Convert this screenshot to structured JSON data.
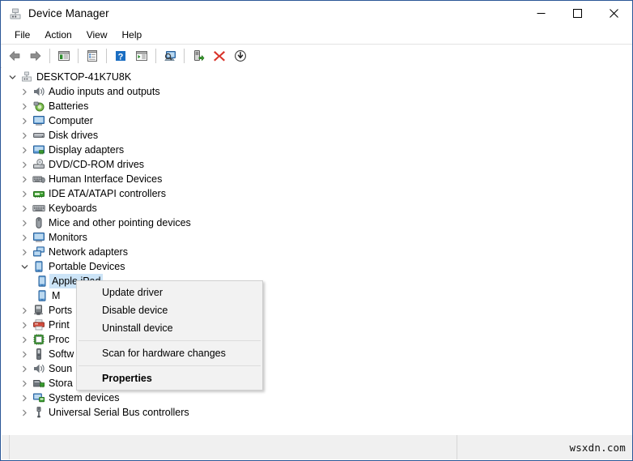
{
  "window": {
    "title": "Device Manager",
    "title_icon": "device-manager-icon",
    "caption": {
      "minimize": "minimize-icon",
      "maximize": "maximize-icon",
      "close": "close-icon"
    }
  },
  "menubar": {
    "items": [
      {
        "label": "File"
      },
      {
        "label": "Action"
      },
      {
        "label": "View"
      },
      {
        "label": "Help"
      }
    ]
  },
  "toolbar": {
    "buttons": [
      {
        "name": "back-button",
        "icon": "back-arrow-icon"
      },
      {
        "name": "forward-button",
        "icon": "forward-arrow-icon"
      },
      {
        "name": "show-hide-console-tree-button",
        "icon": "console-tree-icon"
      },
      {
        "name": "properties-button",
        "icon": "properties-icon"
      },
      {
        "name": "help-button",
        "icon": "help-question-icon"
      },
      {
        "name": "show-hide-action-pane-button",
        "icon": "action-pane-icon"
      },
      {
        "name": "scan-for-hardware-changes-button",
        "icon": "scan-hardware-icon"
      },
      {
        "name": "update-driver-button",
        "icon": "update-driver-icon"
      },
      {
        "name": "uninstall-device-button",
        "icon": "red-x-icon"
      },
      {
        "name": "disable-device-button",
        "icon": "disable-down-arrow-icon"
      }
    ]
  },
  "tree": {
    "root": {
      "label": "DESKTOP-41K7U8K",
      "icon": "computer-root-icon",
      "expanded": true
    },
    "nodes": [
      {
        "label": "Audio inputs and outputs",
        "icon": "speaker-icon",
        "depth": 1,
        "expanded": false
      },
      {
        "label": "Batteries",
        "icon": "battery-icon",
        "depth": 1,
        "expanded": false
      },
      {
        "label": "Computer",
        "icon": "monitor-icon",
        "depth": 1,
        "expanded": false
      },
      {
        "label": "Disk drives",
        "icon": "disk-drive-icon",
        "depth": 1,
        "expanded": false
      },
      {
        "label": "Display adapters",
        "icon": "display-adapter-icon",
        "depth": 1,
        "expanded": false
      },
      {
        "label": "DVD/CD-ROM drives",
        "icon": "optical-drive-icon",
        "depth": 1,
        "expanded": false
      },
      {
        "label": "Human Interface Devices",
        "icon": "hid-icon",
        "depth": 1,
        "expanded": false
      },
      {
        "label": "IDE ATA/ATAPI controllers",
        "icon": "ide-controller-icon",
        "depth": 1,
        "expanded": false
      },
      {
        "label": "Keyboards",
        "icon": "keyboard-icon",
        "depth": 1,
        "expanded": false
      },
      {
        "label": "Mice and other pointing devices",
        "icon": "mouse-icon",
        "depth": 1,
        "expanded": false
      },
      {
        "label": "Monitors",
        "icon": "monitor-icon",
        "depth": 1,
        "expanded": false
      },
      {
        "label": "Network adapters",
        "icon": "network-adapter-icon",
        "depth": 1,
        "expanded": false
      },
      {
        "label": "Portable Devices",
        "icon": "portable-device-icon",
        "depth": 1,
        "expanded": true
      },
      {
        "label": "Apple iPad",
        "icon": "portable-device-icon",
        "depth": 2,
        "selected": true
      },
      {
        "label": "M",
        "icon": "portable-device-icon",
        "depth": 2,
        "occluded": true
      },
      {
        "label": "Ports",
        "icon": "port-icon",
        "depth": 1,
        "expanded": false,
        "occluded": true
      },
      {
        "label": "Print",
        "icon": "printer-icon",
        "depth": 1,
        "expanded": false,
        "occluded": true
      },
      {
        "label": "Proc",
        "icon": "processor-icon",
        "depth": 1,
        "expanded": false,
        "occluded": true
      },
      {
        "label": "Softw",
        "icon": "software-device-icon",
        "depth": 1,
        "expanded": false,
        "occluded": true
      },
      {
        "label": "Soun",
        "icon": "speaker-icon",
        "depth": 1,
        "expanded": false,
        "occluded": true
      },
      {
        "label": "Stora",
        "icon": "storage-controller-icon",
        "depth": 1,
        "expanded": false,
        "occluded": true
      },
      {
        "label": "System devices",
        "icon": "system-device-icon",
        "depth": 1,
        "expanded": false
      },
      {
        "label": "Universal Serial Bus controllers",
        "icon": "usb-icon",
        "depth": 1,
        "expanded": false
      }
    ]
  },
  "context_menu": {
    "items": [
      {
        "label": "Update driver",
        "bold": false
      },
      {
        "label": "Disable device",
        "bold": false
      },
      {
        "label": "Uninstall device",
        "bold": false
      },
      {
        "separator_after": true
      },
      {
        "label": "Scan for hardware changes",
        "bold": false
      },
      {
        "separator_after": true
      },
      {
        "label": "Properties",
        "bold": true
      }
    ]
  },
  "statusbar": {
    "watermark": "wsxdn.com"
  },
  "colors": {
    "window_border": "#2b5797",
    "selection": "#cce4f7",
    "menu_bg": "#f2f2f2",
    "statusbar_bg": "#f0f0f0",
    "accent_red": "#d9342b",
    "accent_blue": "#1b6ec2",
    "accent_green": "#3a9c2f"
  }
}
